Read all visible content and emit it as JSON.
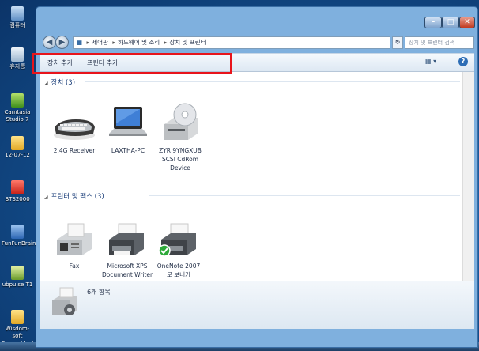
{
  "desktop": {
    "icons": [
      {
        "label": "컴퓨터",
        "icon": "computer-icon"
      },
      {
        "label": "휴지통",
        "icon": "recycle-bin-icon"
      },
      {
        "label": "Camtasia Studio 7",
        "icon": "camtasia-icon"
      },
      {
        "label": "12-07-12",
        "icon": "folder-icon"
      },
      {
        "label": "BTS2000",
        "icon": "app-icon"
      },
      {
        "label": "FunFunBrain",
        "icon": "app-icon"
      },
      {
        "label": "ubpulse T1",
        "icon": "app-icon"
      },
      {
        "label": "Wisdom-soft ScreenHunt...",
        "icon": "folder-icon"
      }
    ]
  },
  "window": {
    "breadcrumb": [
      "제어판",
      "하드웨어 및 소리",
      "장치 및 프린터"
    ],
    "search_placeholder": "장치 및 프린터 검색",
    "toolbar": {
      "add_device": "장치 추가",
      "add_printer": "프린터 추가"
    },
    "groups": {
      "devices": {
        "title": "장치 (3)",
        "items": [
          {
            "label": "2.4G Receiver",
            "icon": "keyboard-icon"
          },
          {
            "label": "LAXTHA-PC",
            "icon": "laptop-icon"
          },
          {
            "label": "ZYR 9YNGXUB SCSI CdRom Device",
            "icon": "cdrom-icon"
          }
        ]
      },
      "printers": {
        "title": "프린터 및 팩스 (3)",
        "items": [
          {
            "label": "Fax",
            "icon": "fax-icon"
          },
          {
            "label": "Microsoft XPS Document Writer",
            "icon": "printer-icon"
          },
          {
            "label": "OneNote 2007로 보내기",
            "icon": "printer-default-icon"
          }
        ]
      }
    },
    "status": {
      "text": "6개 항목"
    }
  },
  "colors": {
    "highlight": "#e8141b",
    "group_header": "#1c3f7a"
  }
}
